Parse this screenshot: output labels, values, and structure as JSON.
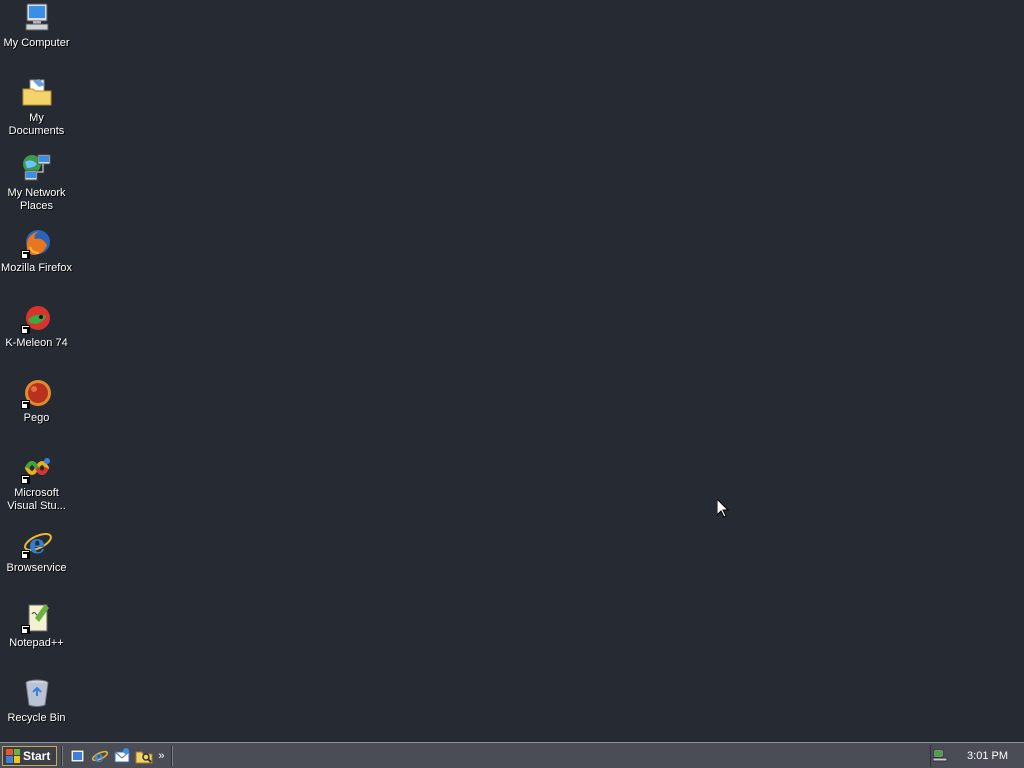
{
  "desktop": {
    "icons": [
      {
        "label": "My Computer",
        "icon": "computer-icon",
        "shortcut": false
      },
      {
        "label": "My Documents",
        "icon": "documents-folder-icon",
        "shortcut": false
      },
      {
        "label": "My Network Places",
        "icon": "network-places-icon",
        "shortcut": false
      },
      {
        "label": "Mozilla Firefox",
        "icon": "firefox-icon",
        "shortcut": true
      },
      {
        "label": "K-Meleon 74",
        "icon": "k-meleon-icon",
        "shortcut": true
      },
      {
        "label": "Pego",
        "icon": "pego-icon",
        "shortcut": true
      },
      {
        "label": "Microsoft Visual Stu...",
        "icon": "visual-studio-icon",
        "shortcut": true
      },
      {
        "label": "Browservice",
        "icon": "internet-explorer-icon",
        "shortcut": true
      },
      {
        "label": "Notepad++",
        "icon": "notepad-plus-plus-icon",
        "shortcut": true
      },
      {
        "label": "Recycle Bin",
        "icon": "recycle-bin-icon",
        "shortcut": false
      }
    ]
  },
  "taskbar": {
    "start_label": "Start",
    "quick_launch": [
      {
        "icon": "show-desktop-icon"
      },
      {
        "icon": "internet-explorer-icon"
      },
      {
        "icon": "outlook-express-icon"
      },
      {
        "icon": "windows-explorer-icon"
      }
    ],
    "overflow": "»",
    "tray": {
      "network_icon": "network-status-icon",
      "clock": "3:01 PM"
    }
  },
  "colors": {
    "desktop_bg": "#252a33",
    "taskbar_bg": "#4a4d55",
    "start_border": "#c9a75a"
  }
}
